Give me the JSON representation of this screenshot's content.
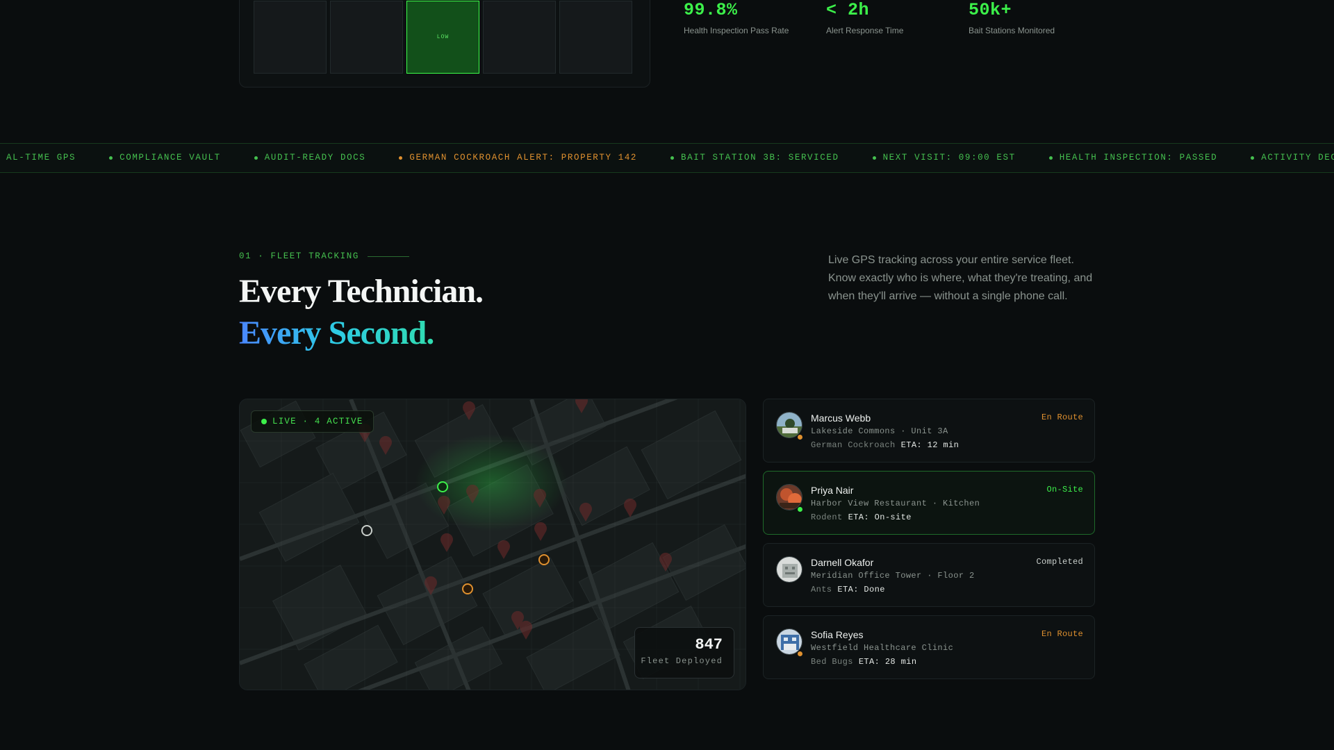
{
  "grid": {
    "active_label": "LOW"
  },
  "stats": [
    {
      "value": "99.8%",
      "label": "Health Inspection Pass Rate"
    },
    {
      "value": "< 2h",
      "label": "Alert Response Time"
    },
    {
      "value": "50k+",
      "label": "Bait Stations Monitored"
    }
  ],
  "ticker": [
    {
      "text": "AL-TIME GPS",
      "alert": false
    },
    {
      "text": "COMPLIANCE VAULT",
      "alert": false
    },
    {
      "text": "AUDIT-READY DOCS",
      "alert": false
    },
    {
      "text": "GERMAN COCKROACH ALERT: PROPERTY 142",
      "alert": true
    },
    {
      "text": "BAIT STATION 3B: SERVICED",
      "alert": false
    },
    {
      "text": "NEXT VISIT: 09:00 EST",
      "alert": false
    },
    {
      "text": "HEALTH INSPECTION: PASSED",
      "alert": false
    },
    {
      "text": "ACTIVITY DECLINING: ZONE",
      "alert": false
    }
  ],
  "section": {
    "eyebrow": "01 · FLEET TRACKING",
    "title_line1": "Every Technician.",
    "title_line2": "Every Second.",
    "description": "Live GPS tracking across your entire service fleet. Know exactly who is where, what they're treating, and when they'll arrive — without a single phone call."
  },
  "map": {
    "live_label": "LIVE · 4 ACTIVE",
    "fleet_count": "847",
    "fleet_label": "Fleet Deployed"
  },
  "technicians": [
    {
      "name": "Marcus Webb",
      "location": "Lakeside Commons · Unit 3A",
      "pest": "German Cockroach",
      "eta": "ETA: 12 min",
      "status": "En Route",
      "status_color": "#e0912f"
    },
    {
      "name": "Priya Nair",
      "location": "Harbor View Restaurant · Kitchen",
      "pest": "Rodent",
      "eta": "ETA: On-site",
      "status": "On-Site",
      "status_color": "#3cf04a"
    },
    {
      "name": "Darnell Okafor",
      "location": "Meridian Office Tower · Floor 2",
      "pest": "Ants",
      "eta": "ETA: Done",
      "status": "Completed",
      "status_color": "#c9cfcb"
    },
    {
      "name": "Sofia Reyes",
      "location": "Westfield Healthcare Clinic",
      "pest": "Bed Bugs",
      "eta": "ETA: 28 min",
      "status": "En Route",
      "status_color": "#e0912f"
    }
  ],
  "colors": {
    "accent": "#3cf04a",
    "alert": "#e0912f",
    "background": "#0a0d0e"
  }
}
